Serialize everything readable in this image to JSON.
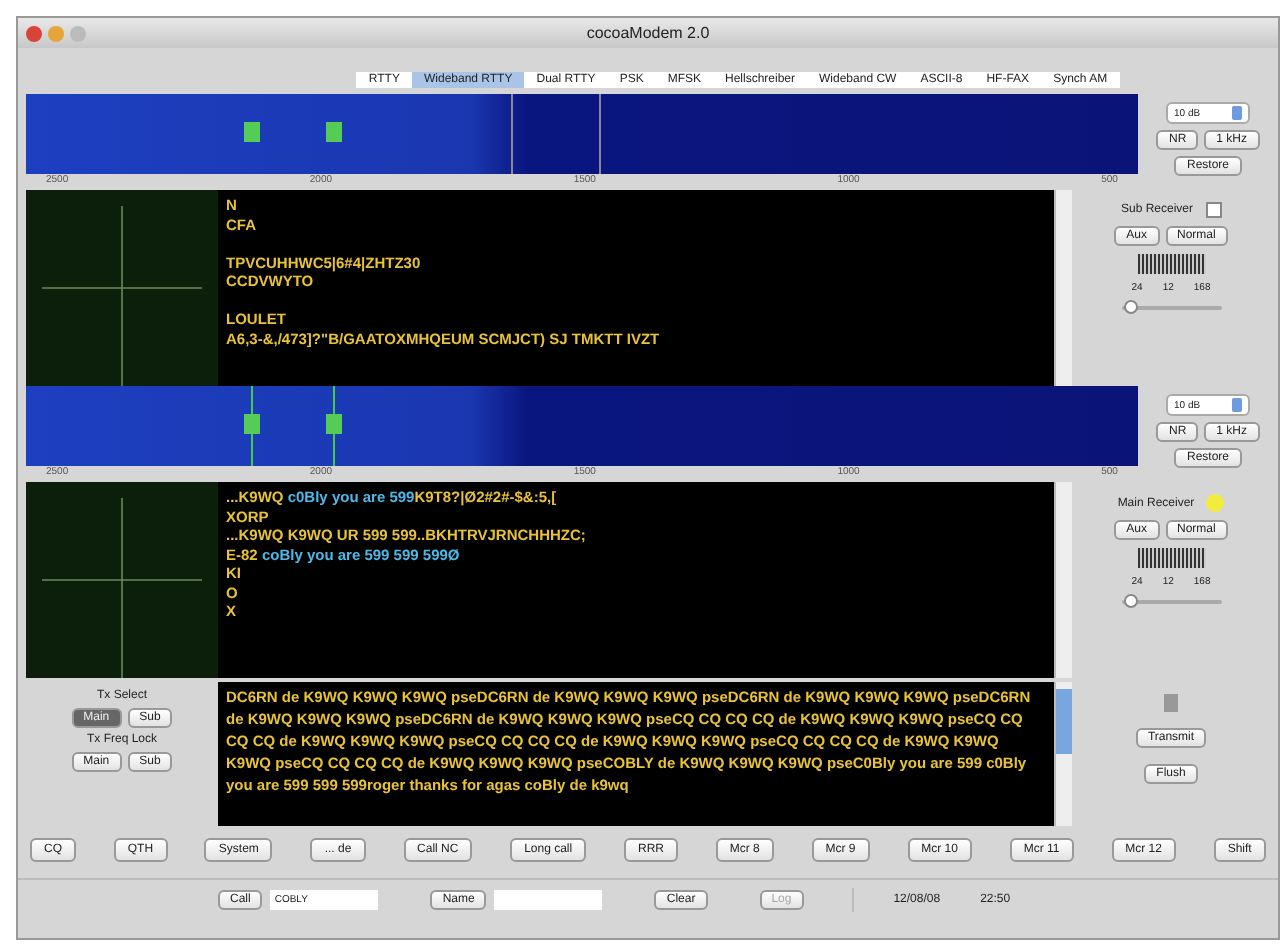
{
  "window": {
    "title": "cocoaModem 2.0"
  },
  "tabs": [
    {
      "label": "RTTY",
      "selected": false
    },
    {
      "label": "Wideband RTTY",
      "selected": true
    },
    {
      "label": "Dual RTTY",
      "selected": false
    },
    {
      "label": "PSK",
      "selected": false
    },
    {
      "label": "MFSK",
      "selected": false
    },
    {
      "label": "Hellschreiber",
      "selected": false
    },
    {
      "label": "Wideband CW",
      "selected": false
    },
    {
      "label": "ASCII-8",
      "selected": false
    },
    {
      "label": "HF-FAX",
      "selected": false
    },
    {
      "label": "Synch AM",
      "selected": false
    }
  ],
  "receivers": [
    {
      "scale": [
        "2500",
        "2000",
        "1500",
        "1000",
        "500"
      ],
      "range": "10 dB",
      "buttons": [
        "NR",
        "1 kHz"
      ],
      "restore": "Restore",
      "title": "Sub Receiver",
      "kind": "checkbox",
      "checked": false,
      "aux": "Aux",
      "normal": "Normal",
      "meter_labels": [
        "24",
        "12",
        "168"
      ],
      "level": 0.05,
      "paragraphs": [
        {
          "lines": [
            {
              "segments": [
                {
                  "text": "N",
                  "color": "#e8c23a"
                }
              ]
            },
            {
              "segments": [
                {
                  "text": "CFA",
                  "color": "#e8c23a"
                }
              ]
            }
          ]
        },
        {
          "lines": [
            {
              "segments": [
                {
                  "text": "TPVCUHHWC5|6#4|ZHTZ30",
                  "color": "#e8c23a"
                }
              ]
            },
            {
              "segments": [
                {
                  "text": "CCDVWYTO",
                  "color": "#e8c23a"
                }
              ]
            }
          ]
        },
        {
          "lines": [
            {
              "segments": [
                {
                  "text": "LOULET",
                  "color": "#e8c23a"
                }
              ]
            },
            {
              "segments": [
                {
                  "text": "A6,3-&,/473]?\"B/GAATOXMHQEUM SCMJCT) SJ TMKTT IVZT",
                  "color": "#e8c23a"
                }
              ]
            }
          ]
        }
      ]
    },
    {
      "scale": [
        "2500",
        "2000",
        "1500",
        "1000",
        "500"
      ],
      "range": "10 dB",
      "buttons": [
        "NR",
        "1 kHz"
      ],
      "restore": "Restore",
      "title": "Main Receiver",
      "kind": "light",
      "checked": true,
      "aux": "Aux",
      "normal": "Normal",
      "meter_labels": [
        "24",
        "12",
        "168"
      ],
      "level": 0.05,
      "paragraphs": [
        {
          "lines": [
            {
              "segments": [
                {
                  "text": "...K9WQ ",
                  "color": "#e8c23a"
                },
                {
                  "text": "c0Bly you are 599",
                  "color": "#4fb8e8"
                },
                {
                  "text": "K9T8?|Ø2#2#-$&:5,[",
                  "color": "#e8c23a"
                }
              ]
            },
            {
              "segments": [
                {
                  "text": "XORP",
                  "color": "#e8c23a"
                }
              ]
            },
            {
              "segments": [
                {
                  "text": "...K9WQ K9WQ UR 599 599..BKHTRVJRNCHHHZC;",
                  "color": "#e8c23a"
                }
              ]
            },
            {
              "segments": [
                {
                  "text": "E-82 ",
                  "color": "#e8c23a"
                },
                {
                  "text": "coBly you are 599 599 599Ø",
                  "color": "#4fb8e8"
                }
              ]
            },
            {
              "segments": [
                {
                  "text": "KI",
                  "color": "#e8c23a"
                }
              ]
            },
            {
              "segments": [
                {
                  "text": "O",
                  "color": "#e8c23a"
                }
              ]
            },
            {
              "segments": [
                {
                  "text": "X",
                  "color": "#e8c23a"
                }
              ]
            }
          ]
        }
      ]
    }
  ],
  "tx_select": {
    "label": "Tx Select",
    "options": [
      {
        "label": "Main",
        "selected": true
      },
      {
        "label": "Sub",
        "selected": false
      }
    ]
  },
  "tx_freq_lock": {
    "label": "Tx Freq Lock",
    "options": [
      {
        "label": "Main",
        "selected": false
      },
      {
        "label": "Sub",
        "selected": false
      }
    ]
  },
  "transmit_text": "DC6RN de K9WQ K9WQ K9WQ pseDC6RN de K9WQ K9WQ K9WQ pseDC6RN de K9WQ K9WQ K9WQ pseDC6RN de K9WQ K9WQ K9WQ pseDC6RN de K9WQ K9WQ K9WQ pseCQ CQ CQ CQ de K9WQ K9WQ K9WQ pseCQ CQ CQ CQ de K9WQ K9WQ K9WQ pseCQ CQ CQ CQ de K9WQ K9WQ K9WQ pseCQ CQ CQ CQ de K9WQ K9WQ K9WQ pseCQ CQ CQ CQ de K9WQ K9WQ K9WQ pseCOBLY de K9WQ K9WQ K9WQ pseC0Bly you are 599 c0Bly you are 599 599 599roger thanks for agas coBly de k9wq",
  "transmit_on": false,
  "transmit_button": "Transmit",
  "flush_button": "Flush",
  "macros": [
    "CQ",
    "QTH",
    "System",
    "... de",
    "Call NC",
    "Long call",
    "RRR",
    "Mcr 8",
    "Mcr 9",
    "Mcr 10",
    "Mcr 11",
    "Mcr 12",
    "Shift"
  ],
  "status_bar": {
    "call_button": "Call",
    "call_value": "COBLY",
    "name_button": "Name",
    "clear_button": "Clear",
    "log_button": "Log",
    "log_disabled": true,
    "date": "12/08/08",
    "time": "22:50"
  }
}
